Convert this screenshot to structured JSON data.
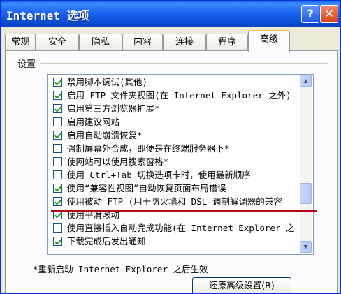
{
  "window": {
    "title": "Internet 选项",
    "help_label": "?",
    "close_label": "✕"
  },
  "tabs": [
    {
      "label": "常规"
    },
    {
      "label": "安全"
    },
    {
      "label": "隐私"
    },
    {
      "label": "内容"
    },
    {
      "label": "连接"
    },
    {
      "label": "程序"
    },
    {
      "label": "高级",
      "active": true
    }
  ],
  "settings": {
    "group_label": "设置",
    "items": [
      {
        "label": "禁用脚本调试(其他)",
        "checked": true
      },
      {
        "label": "启用 FTP 文件夹视图(在 Internet Explorer 之外)",
        "checked": true
      },
      {
        "label": "启用第三方浏览器扩展*",
        "checked": true
      },
      {
        "label": "启用建议网站",
        "checked": false
      },
      {
        "label": "启用自动崩溃恢复*",
        "checked": true
      },
      {
        "label": "强制屏幕外合成，即便是在终端服务器下*",
        "checked": false
      },
      {
        "label": "使网站可以使用搜索窗格*",
        "checked": false
      },
      {
        "label": "使用 Ctrl+Tab 切换选项卡时，使用最新顺序",
        "checked": false
      },
      {
        "label": "使用“兼容性视图”自动恢复页面布局错误",
        "checked": true
      },
      {
        "label": "使用被动 FTP (用于防火墙和 DSL 调制解调器的兼容",
        "checked": true
      },
      {
        "label": "使用平滑滚动",
        "checked": true
      },
      {
        "label": "使用直接插入自动完成功能(在 Internet Explorer 之",
        "checked": false
      },
      {
        "label": "下载完成后发出通知",
        "checked": true
      }
    ]
  },
  "scrollbar": {
    "up_arrow": "▲",
    "down_arrow": "▼",
    "position": 0.72
  },
  "footnote": "*重新启动 Internet Explorer 之后生效",
  "buttons": {
    "restore_label": "还原高级设置(R)"
  }
}
